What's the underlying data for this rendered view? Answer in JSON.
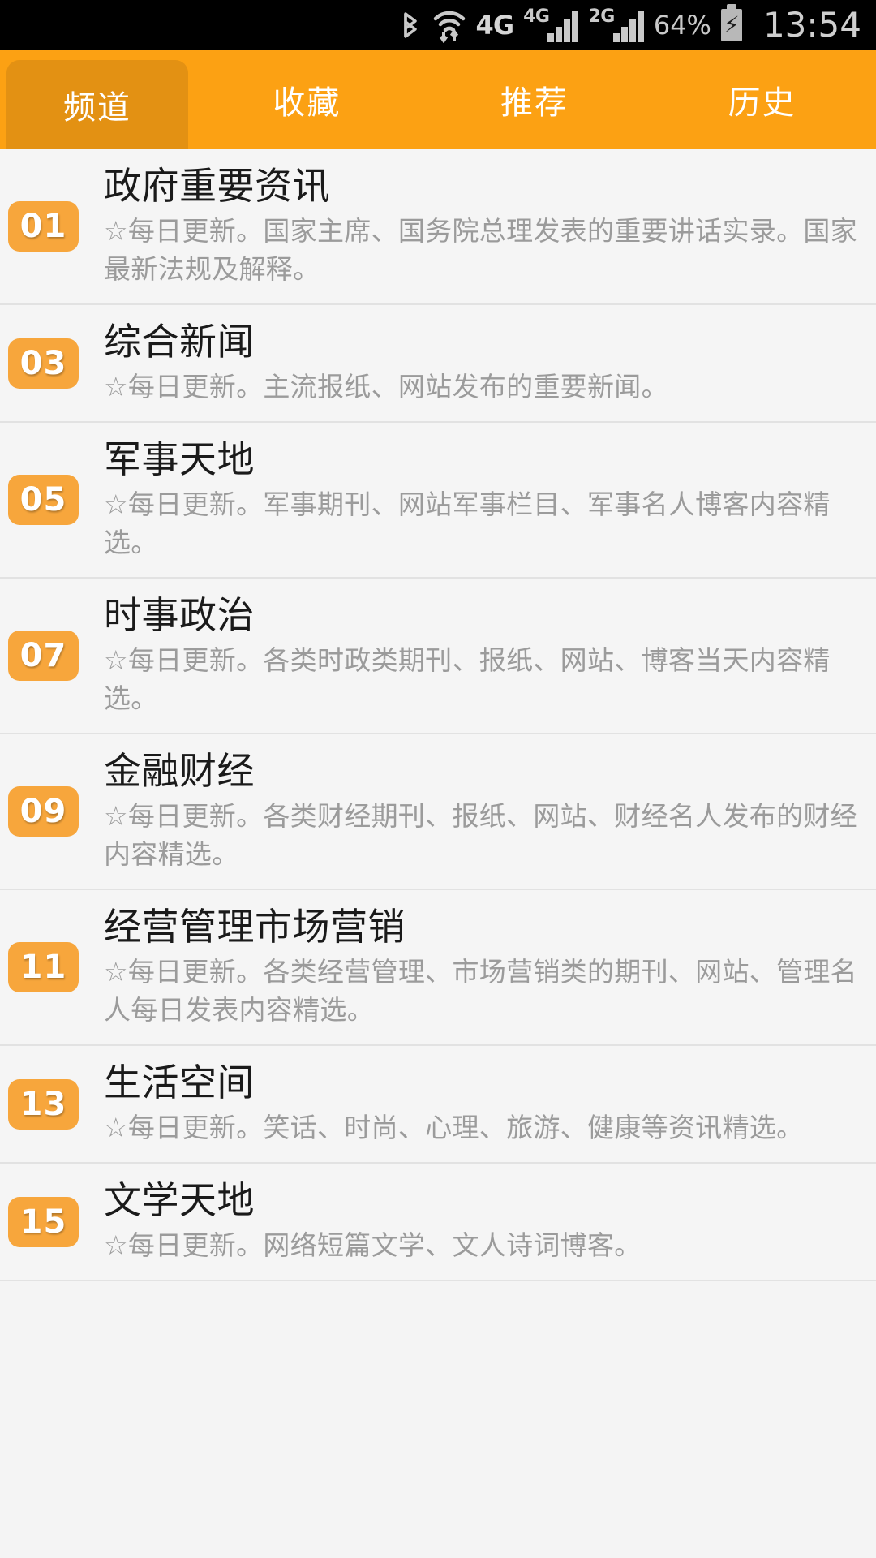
{
  "statusbar": {
    "bluetooth_icon": "bluetooth-icon",
    "wifi_icon": "wifi-icon",
    "network_primary_label": "4G",
    "sim1_label": "4G",
    "sim2_label": "2G",
    "battery_percent": "64%",
    "battery_icon": "battery-charging-icon",
    "clock": "13:54"
  },
  "tabs": [
    {
      "label": "频道",
      "active": true
    },
    {
      "label": "收藏",
      "active": false
    },
    {
      "label": "推荐",
      "active": false
    },
    {
      "label": "历史",
      "active": false
    }
  ],
  "channels": [
    {
      "number": "01",
      "title": "政府重要资讯",
      "desc": "☆每日更新。国家主席、国务院总理发表的重要讲话实录。国家最新法规及解释。"
    },
    {
      "number": "03",
      "title": "综合新闻",
      "desc": "☆每日更新。主流报纸、网站发布的重要新闻。"
    },
    {
      "number": "05",
      "title": "军事天地",
      "desc": "☆每日更新。军事期刊、网站军事栏目、军事名人博客内容精选。"
    },
    {
      "number": "07",
      "title": "时事政治",
      "desc": "☆每日更新。各类时政类期刊、报纸、网站、博客当天内容精选。"
    },
    {
      "number": "09",
      "title": "金融财经",
      "desc": "☆每日更新。各类财经期刊、报纸、网站、财经名人发布的财经内容精选。"
    },
    {
      "number": "11",
      "title": "经营管理市场营销",
      "desc": "☆每日更新。各类经营管理、市场营销类的期刊、网站、管理名人每日发表内容精选。"
    },
    {
      "number": "13",
      "title": "生活空间",
      "desc": "☆每日更新。笑话、时尚、心理、旅游、健康等资讯精选。"
    },
    {
      "number": "15",
      "title": "文学天地",
      "desc": "☆每日更新。网络短篇文学、文人诗词博客。"
    }
  ],
  "colors": {
    "tabbar_bg": "#fca113",
    "tab_active_bg": "#e39113",
    "badge_bg": "#f7a63c",
    "list_bg": "#f5f5f5",
    "divider": "#e2e2e2",
    "title_text": "#1a1a1a",
    "desc_text": "#9b9b9b",
    "statusbar_bg": "#000000"
  }
}
